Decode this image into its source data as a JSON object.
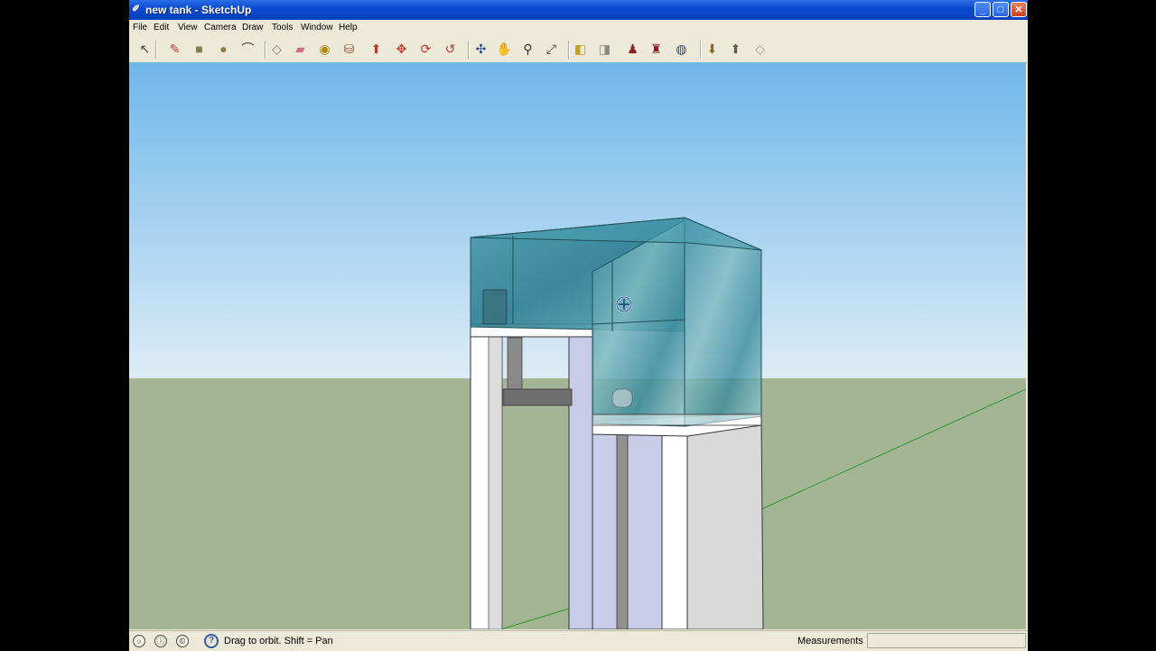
{
  "window": {
    "title": "new tank - SketchUp",
    "buttons": {
      "minimize": "_",
      "maximize": "□",
      "close": "✕"
    }
  },
  "menu": [
    "File",
    "Edit",
    "View",
    "Camera",
    "Draw",
    "Tools",
    "Window",
    "Help"
  ],
  "toolbar": {
    "tools": [
      {
        "name": "select-tool-icon",
        "glyph": "↖",
        "color": "#444"
      },
      {
        "name": "line-tool-icon",
        "glyph": "✎",
        "color": "#c0392b"
      },
      {
        "name": "rectangle-tool-icon",
        "glyph": "■",
        "color": "#8a7a4a"
      },
      {
        "name": "circle-tool-icon",
        "glyph": "●",
        "color": "#8a7a4a"
      },
      {
        "name": "arc-tool-icon",
        "glyph": "⌒",
        "color": "#333"
      },
      {
        "name": "make-component-icon",
        "glyph": "◇",
        "color": "#777"
      },
      {
        "name": "eraser-tool-icon",
        "glyph": "▰",
        "color": "#d46a8a"
      },
      {
        "name": "tape-measure-icon",
        "glyph": "◉",
        "color": "#b8860b"
      },
      {
        "name": "paint-bucket-icon",
        "glyph": "⛁",
        "color": "#a0522d"
      },
      {
        "name": "push-pull-icon",
        "glyph": "⬆",
        "color": "#c0392b"
      },
      {
        "name": "move-tool-icon",
        "glyph": "✥",
        "color": "#c0392b"
      },
      {
        "name": "rotate-tool-icon",
        "glyph": "⟳",
        "color": "#c0392b"
      },
      {
        "name": "offset-tool-icon",
        "glyph": "↺",
        "color": "#c0392b"
      },
      {
        "name": "orbit-tool-icon",
        "glyph": "✣",
        "color": "#1f4fa0"
      },
      {
        "name": "pan-tool-icon",
        "glyph": "✋",
        "color": "#555"
      },
      {
        "name": "zoom-tool-icon",
        "glyph": "⚲",
        "color": "#333"
      },
      {
        "name": "zoom-extents-icon",
        "glyph": "⤢",
        "color": "#333"
      },
      {
        "name": "previous-view-icon",
        "glyph": "◧",
        "color": "#c8a020"
      },
      {
        "name": "next-view-icon",
        "glyph": "◨",
        "color": "#888"
      },
      {
        "name": "position-camera-icon",
        "glyph": "♟",
        "color": "#8b2020"
      },
      {
        "name": "walk-tool-icon",
        "glyph": "♜",
        "color": "#8b2020"
      },
      {
        "name": "look-around-icon",
        "glyph": "◍",
        "color": "#1f4fa0"
      },
      {
        "name": "get-models-icon",
        "glyph": "⬇",
        "color": "#8a6a20"
      },
      {
        "name": "share-model-icon",
        "glyph": "⬆",
        "color": "#6a5a40"
      },
      {
        "name": "share-component-icon",
        "glyph": "◇",
        "color": "#999"
      }
    ]
  },
  "status": {
    "hint": "Drag to orbit.  Shift = Pan",
    "measurements_label": "Measurements",
    "measurements_value": ""
  },
  "colors": {
    "sky_top": "#6fb7ea",
    "sky_bottom": "#dcecf6",
    "ground": "#a4b595",
    "glass": "#3a8898",
    "stand": "#ffffff",
    "green_axis": "#2a9a2a"
  }
}
